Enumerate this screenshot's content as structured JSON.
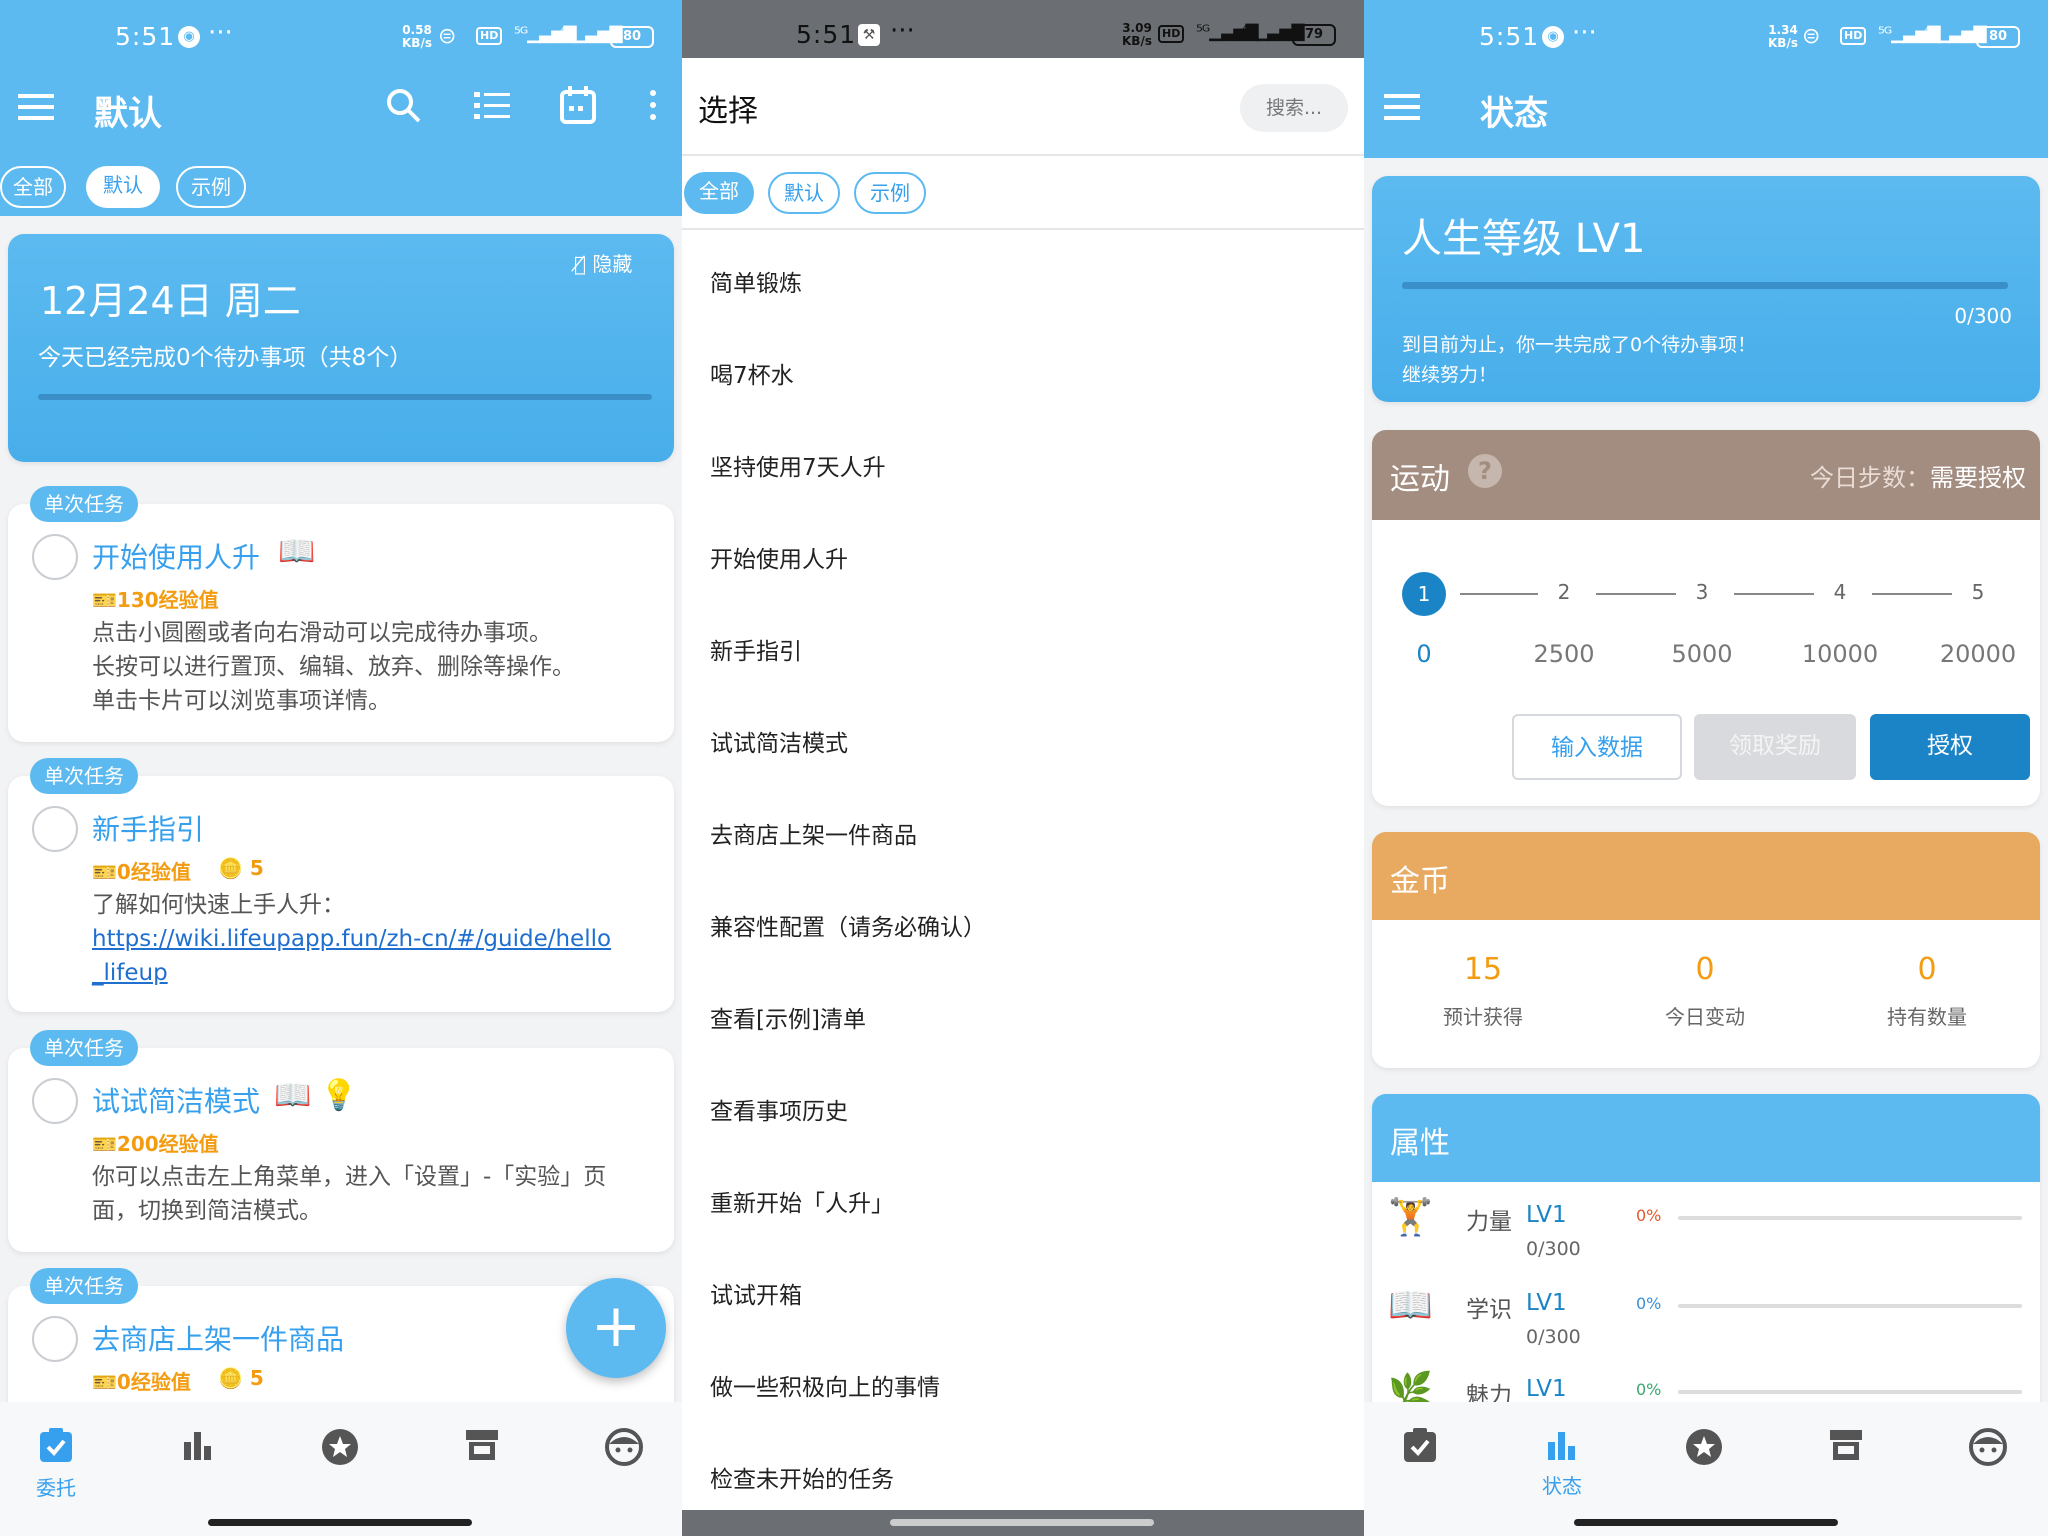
{
  "p1": {
    "status": {
      "time": "5:51",
      "dots": "···",
      "speed_num": "0.58",
      "speed_unit": "KB/s",
      "battery": "80"
    },
    "header": {
      "title": "默认"
    },
    "filters": [
      {
        "label": "全部"
      },
      {
        "label": "默认"
      },
      {
        "label": "示例"
      }
    ],
    "summary": {
      "date": "12月24日 周二",
      "hide_label": "隐藏",
      "subtitle": "今天已经完成0个待办事项（共8个）"
    },
    "tasks": [
      {
        "tag": "单次任务",
        "title": "开始使用人升",
        "exp": "130经验值",
        "coins": "",
        "desc": [
          "点击小圆圈或者向右滑动可以完成待办事项。",
          "长按可以进行置顶、编辑、放弃、删除等操作。",
          "单击卡片可以浏览事项详情。"
        ]
      },
      {
        "tag": "单次任务",
        "title": "新手指引",
        "exp": "0经验值",
        "coins": "5",
        "desc": [
          "了解如何快速上手人升："
        ],
        "link": [
          "https://wiki.lifeupapp.fun/zh-cn/#/guide/hello",
          "_lifeup"
        ]
      },
      {
        "tag": "单次任务",
        "title": "试试简洁模式",
        "exp": "200经验值",
        "coins": "",
        "desc": [
          "你可以点击左上角菜单，进入「设置」-「实验」页",
          "面，切换到简洁模式。"
        ]
      },
      {
        "tag": "单次任务",
        "title": "去商店上架一件商品",
        "exp": "0经验值",
        "coins": "5",
        "desc": []
      }
    ],
    "nav": {
      "active_label": "委托"
    }
  },
  "p2": {
    "status": {
      "time": "5:51",
      "dots": "···",
      "speed_num": "3.09",
      "speed_unit": "KB/s",
      "battery": "79"
    },
    "header": {
      "title": "选择",
      "search_placeholder": "搜索..."
    },
    "filters": [
      {
        "label": "全部"
      },
      {
        "label": "默认"
      },
      {
        "label": "示例"
      }
    ],
    "items": [
      "简单锻炼",
      "喝7杯水",
      "坚持使用7天人升",
      "开始使用人升",
      "新手指引",
      "试试简洁模式",
      "去商店上架一件商品",
      "兼容性配置（请务必确认）",
      "查看[示例]清单",
      "查看事项历史",
      "重新开始「人升」",
      "试试开箱",
      "做一些积极向上的事情",
      "检查未开始的任务"
    ]
  },
  "p3": {
    "status": {
      "time": "5:51",
      "dots": "···",
      "speed_num": "1.34",
      "speed_unit": "KB/s",
      "battery": "80"
    },
    "header": {
      "title": "状态"
    },
    "level": {
      "title": "人生等级 LV1",
      "progress_text": "0/300",
      "progress": 0,
      "line1": "到目前为止，你一共完成了0个待办事项！",
      "line2": "继续努力！"
    },
    "exercise": {
      "title": "运动",
      "help": "?",
      "steps_label": "今日步数：",
      "steps_value": "需要授权",
      "steps": [
        {
          "num": "1",
          "val": "0"
        },
        {
          "num": "2",
          "val": "2500"
        },
        {
          "num": "3",
          "val": "5000"
        },
        {
          "num": "4",
          "val": "10000"
        },
        {
          "num": "5",
          "val": "20000"
        }
      ],
      "btn_input": "输入数据",
      "btn_reward": "领取奖励",
      "btn_auth": "授权"
    },
    "coins": {
      "title": "金币",
      "stats": [
        {
          "value": "15",
          "label": "预计获得"
        },
        {
          "value": "0",
          "label": "今日变动"
        },
        {
          "value": "0",
          "label": "持有数量"
        }
      ]
    },
    "attrs": {
      "title": "属性",
      "rows": [
        {
          "name": "力量",
          "lv": "LV1",
          "exp": "0/300",
          "pct": "0%",
          "icon": "dumbbell-icon",
          "pct_color": "#e05a2b"
        },
        {
          "name": "学识",
          "lv": "LV1",
          "exp": "0/300",
          "pct": "0%",
          "icon": "book-icon",
          "pct_color": "#3a8fd8"
        },
        {
          "name": "魅力",
          "lv": "LV1",
          "exp": "",
          "pct": "0%",
          "icon": "plant-icon",
          "pct_color": "#3aa870"
        }
      ]
    },
    "nav": {
      "active_label": "状态"
    }
  }
}
